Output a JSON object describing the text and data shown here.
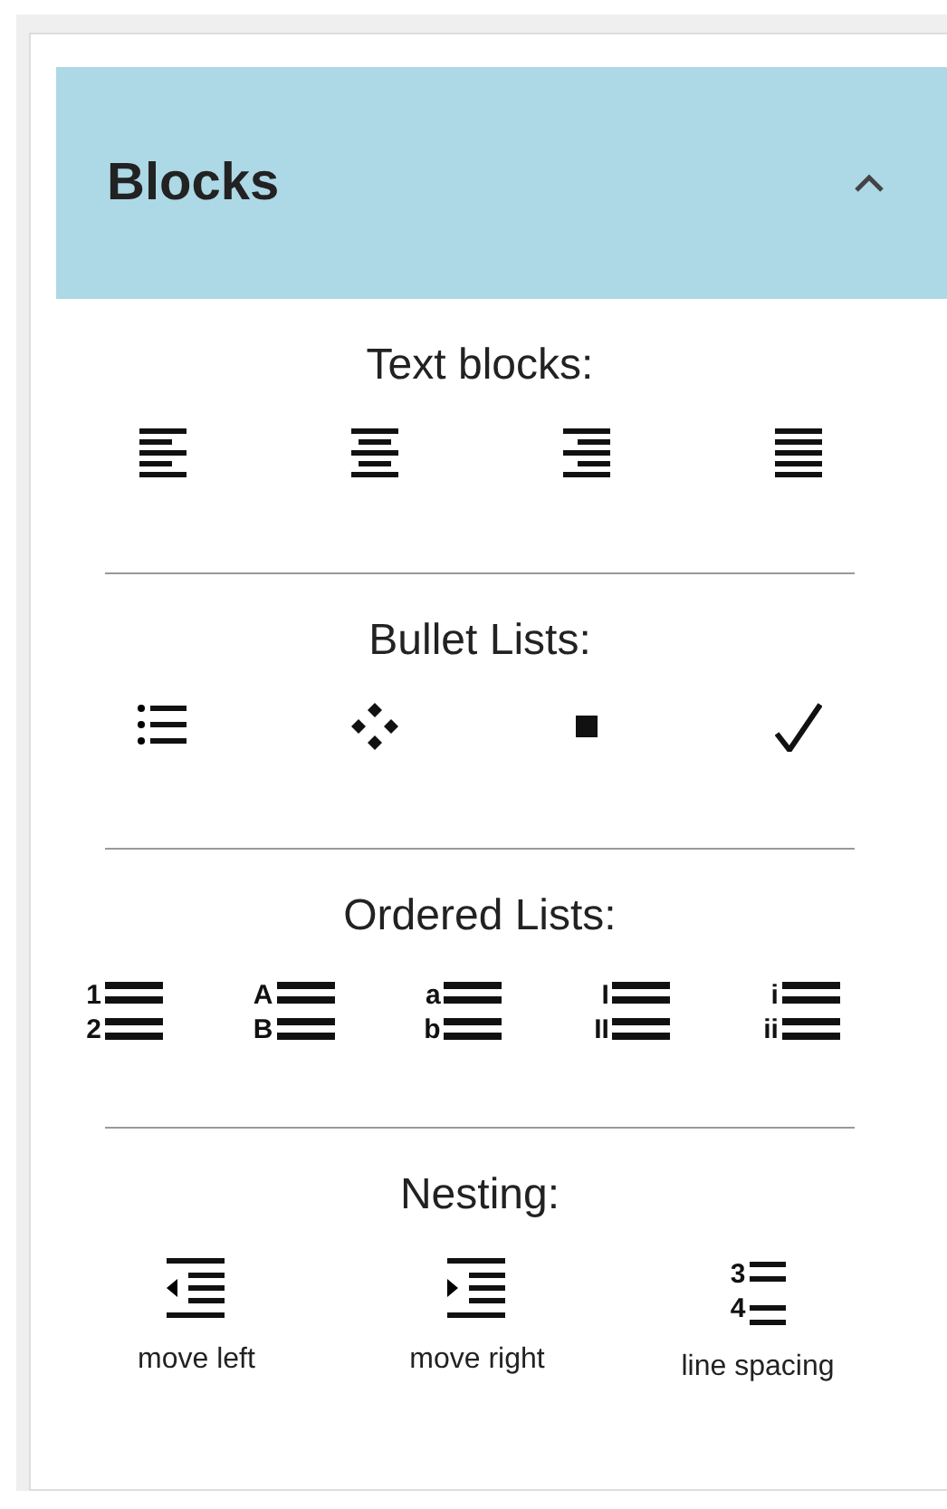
{
  "panel": {
    "title": "Blocks",
    "expanded": true
  },
  "sections": [
    {
      "heading": "Text blocks:",
      "items": [
        {
          "kind": "left"
        },
        {
          "kind": "center"
        },
        {
          "kind": "right"
        },
        {
          "kind": "justify"
        }
      ]
    },
    {
      "heading": "Bullet Lists:",
      "items": [
        {
          "kind": "dots"
        },
        {
          "kind": "diamond"
        },
        {
          "kind": "square"
        },
        {
          "kind": "check"
        }
      ]
    },
    {
      "heading": "Ordered Lists:",
      "items": [
        {
          "kind": "ordered",
          "markers": [
            "1",
            "2"
          ]
        },
        {
          "kind": "ordered",
          "markers": [
            "A",
            "B"
          ]
        },
        {
          "kind": "ordered",
          "markers": [
            "a",
            "b"
          ]
        },
        {
          "kind": "ordered",
          "markers": [
            "I",
            "II"
          ]
        },
        {
          "kind": "ordered",
          "markers": [
            "i",
            "ii"
          ]
        }
      ]
    },
    {
      "heading": "Nesting:",
      "items": [
        {
          "kind": "outdent",
          "label": "move left"
        },
        {
          "kind": "indent",
          "label": "move right"
        },
        {
          "kind": "spacing",
          "markers": [
            "3",
            "4"
          ],
          "label": "line spacing"
        }
      ]
    }
  ]
}
